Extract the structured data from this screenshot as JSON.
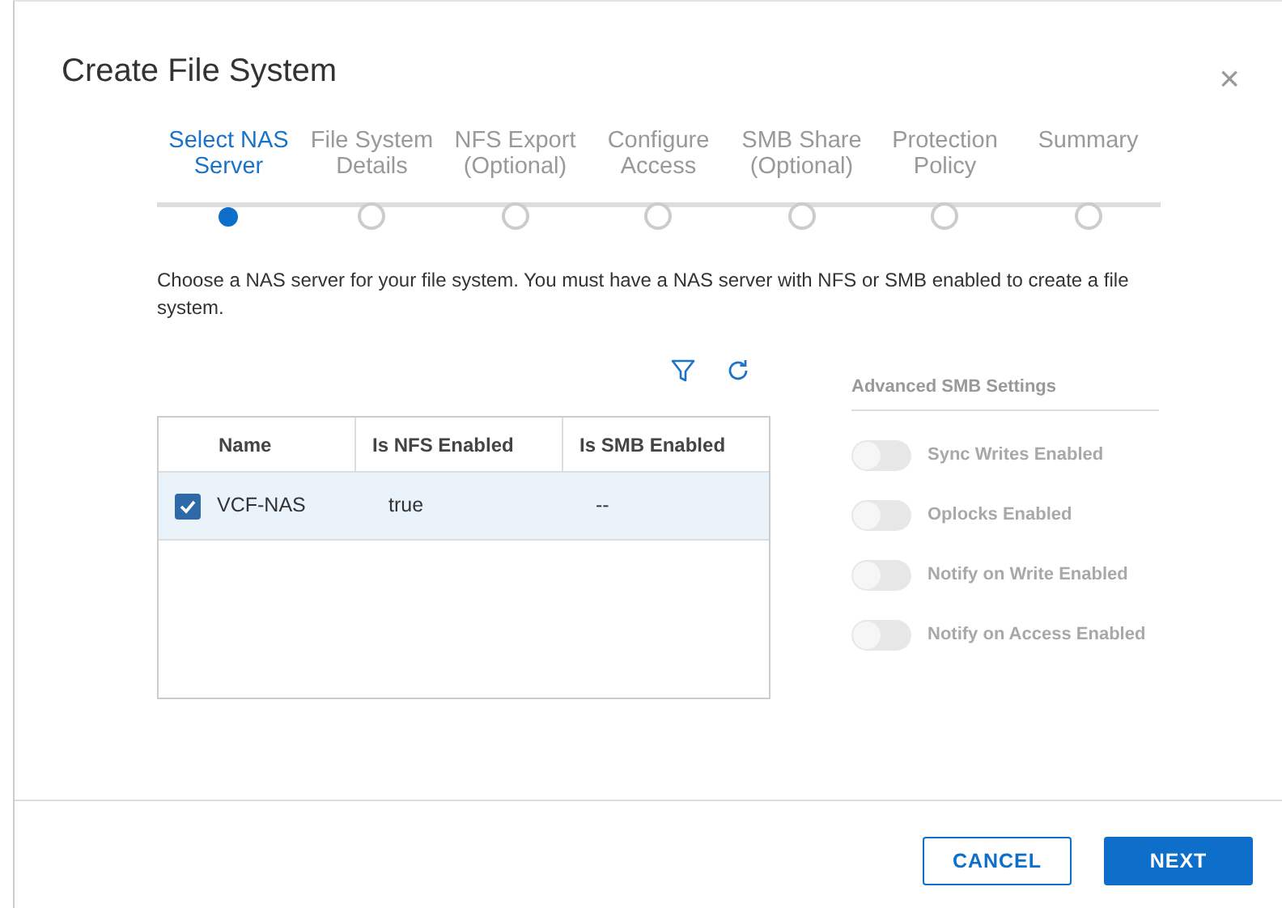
{
  "dialog": {
    "title": "Create File System",
    "close": "×"
  },
  "steps": [
    {
      "label": "Select NAS Server",
      "selected": true
    },
    {
      "label": "File System Details",
      "selected": false
    },
    {
      "label": "NFS Export (Optional)",
      "selected": false
    },
    {
      "label": "Configure Access",
      "selected": false
    },
    {
      "label": "SMB Share (Optional)",
      "selected": false
    },
    {
      "label": "Protection Policy",
      "selected": false
    },
    {
      "label": "Summary",
      "selected": false
    }
  ],
  "description": "Choose a NAS server for your file system. You must have a NAS server with NFS or SMB enabled to create a file system.",
  "table": {
    "columns": [
      "Name",
      "Is NFS Enabled",
      "Is SMB Enabled"
    ],
    "rows": [
      {
        "cells": [
          "VCF-NAS",
          "true",
          "--"
        ],
        "selected": true
      }
    ]
  },
  "smb_settings": {
    "title": "Advanced SMB Settings",
    "toggles": [
      {
        "label": "Sync Writes Enabled",
        "on": false,
        "disabled": true
      },
      {
        "label": "Oplocks Enabled",
        "on": false,
        "disabled": true
      },
      {
        "label": "Notify on Write Enabled",
        "on": false,
        "disabled": true
      },
      {
        "label": "Notify on Access Enabled",
        "on": false,
        "disabled": true
      }
    ]
  },
  "buttons": [
    {
      "label": "CANCEL",
      "kind": "secondary"
    },
    {
      "label": "NEXT",
      "kind": "primary"
    }
  ]
}
